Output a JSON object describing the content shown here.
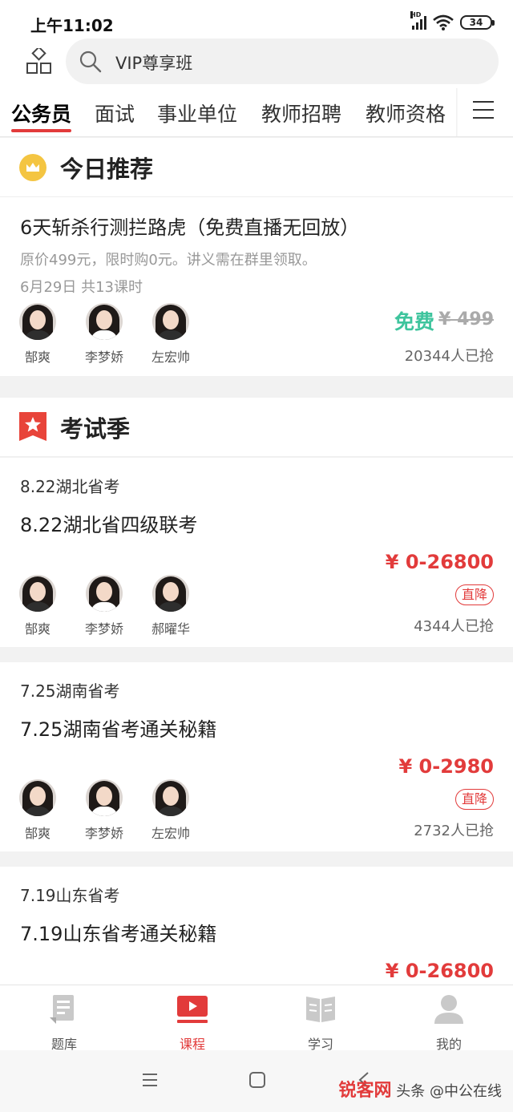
{
  "status_bar": {
    "time": "上午11:02",
    "battery": "34",
    "network": "HD"
  },
  "header": {
    "search_placeholder": "VIP尊享班"
  },
  "tabs": [
    {
      "label": "公务员"
    },
    {
      "label": "面试"
    },
    {
      "label": "事业单位"
    },
    {
      "label": "教师招聘"
    },
    {
      "label": "教师资格"
    }
  ],
  "today": {
    "title": "今日推荐",
    "course": {
      "title": "6天斩杀行测拦路虎（免费直播无回放）",
      "desc": "原价499元，限时购0元。讲义需在群里领取。",
      "meta": "6月29日 共13课时",
      "teachers": [
        "郜爽",
        "李梦娇",
        "左宏帅"
      ],
      "price": "免费",
      "original_price": "¥ 499",
      "sold": "20344人已抢"
    }
  },
  "exam": {
    "title": "考试季",
    "cards": [
      {
        "sub": "8.22湖北省考",
        "title": "8.22湖北省四级联考",
        "teachers": [
          "郜爽",
          "李梦娇",
          "郝曜华"
        ],
        "price": "¥ 0-26800",
        "badge": "直降",
        "sold": "4344人已抢"
      },
      {
        "sub": "7.25湖南省考",
        "title": "7.25湖南省考通关秘籍",
        "teachers": [
          "郜爽",
          "李梦娇",
          "左宏帅"
        ],
        "price": "¥ 0-2980",
        "badge": "直降",
        "sold": "2732人已抢"
      },
      {
        "sub": "7.19山东省考",
        "title": "7.19山东省考通关秘籍",
        "price": "¥ 0-26800"
      }
    ]
  },
  "bottom_nav": [
    {
      "label": "题库",
      "icon": "question-bank-icon"
    },
    {
      "label": "课程",
      "icon": "course-tv-icon"
    },
    {
      "label": "学习",
      "icon": "book-icon"
    },
    {
      "label": "我的",
      "icon": "profile-icon"
    }
  ],
  "watermark": {
    "brand": "锐客网",
    "text": "头条 @中公在线"
  },
  "colors": {
    "accent": "#e23b3b",
    "free": "#3ec49d",
    "crown": "#f4c542"
  }
}
